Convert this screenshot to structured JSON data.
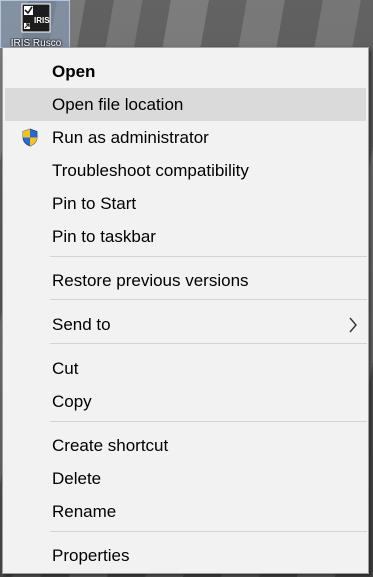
{
  "desktop": {
    "shortcut": {
      "icon_name": "iris-app-icon",
      "icon_text": "IRIS",
      "caption": "IRIS Rusco"
    }
  },
  "context_menu": {
    "items": [
      {
        "label": "Open",
        "bold": true
      },
      {
        "label": "Open file location",
        "highlighted": true
      },
      {
        "label": "Run as administrator",
        "icon": "uac-shield-icon"
      },
      {
        "label": "Troubleshoot compatibility"
      },
      {
        "label": "Pin to Start"
      },
      {
        "label": "Pin to taskbar"
      },
      {
        "label": "Restore previous versions"
      },
      {
        "label": "Send to",
        "submenu": true
      },
      {
        "label": "Cut"
      },
      {
        "label": "Copy"
      },
      {
        "label": "Create shortcut"
      },
      {
        "label": "Delete"
      },
      {
        "label": "Rename"
      },
      {
        "label": "Properties"
      }
    ]
  },
  "colors": {
    "menu_background": "#f2f2f2",
    "highlight": "#dadada",
    "separator": "#d3d3d3",
    "shield_blue": "#2a6ad8",
    "shield_yellow": "#f4c21b"
  }
}
